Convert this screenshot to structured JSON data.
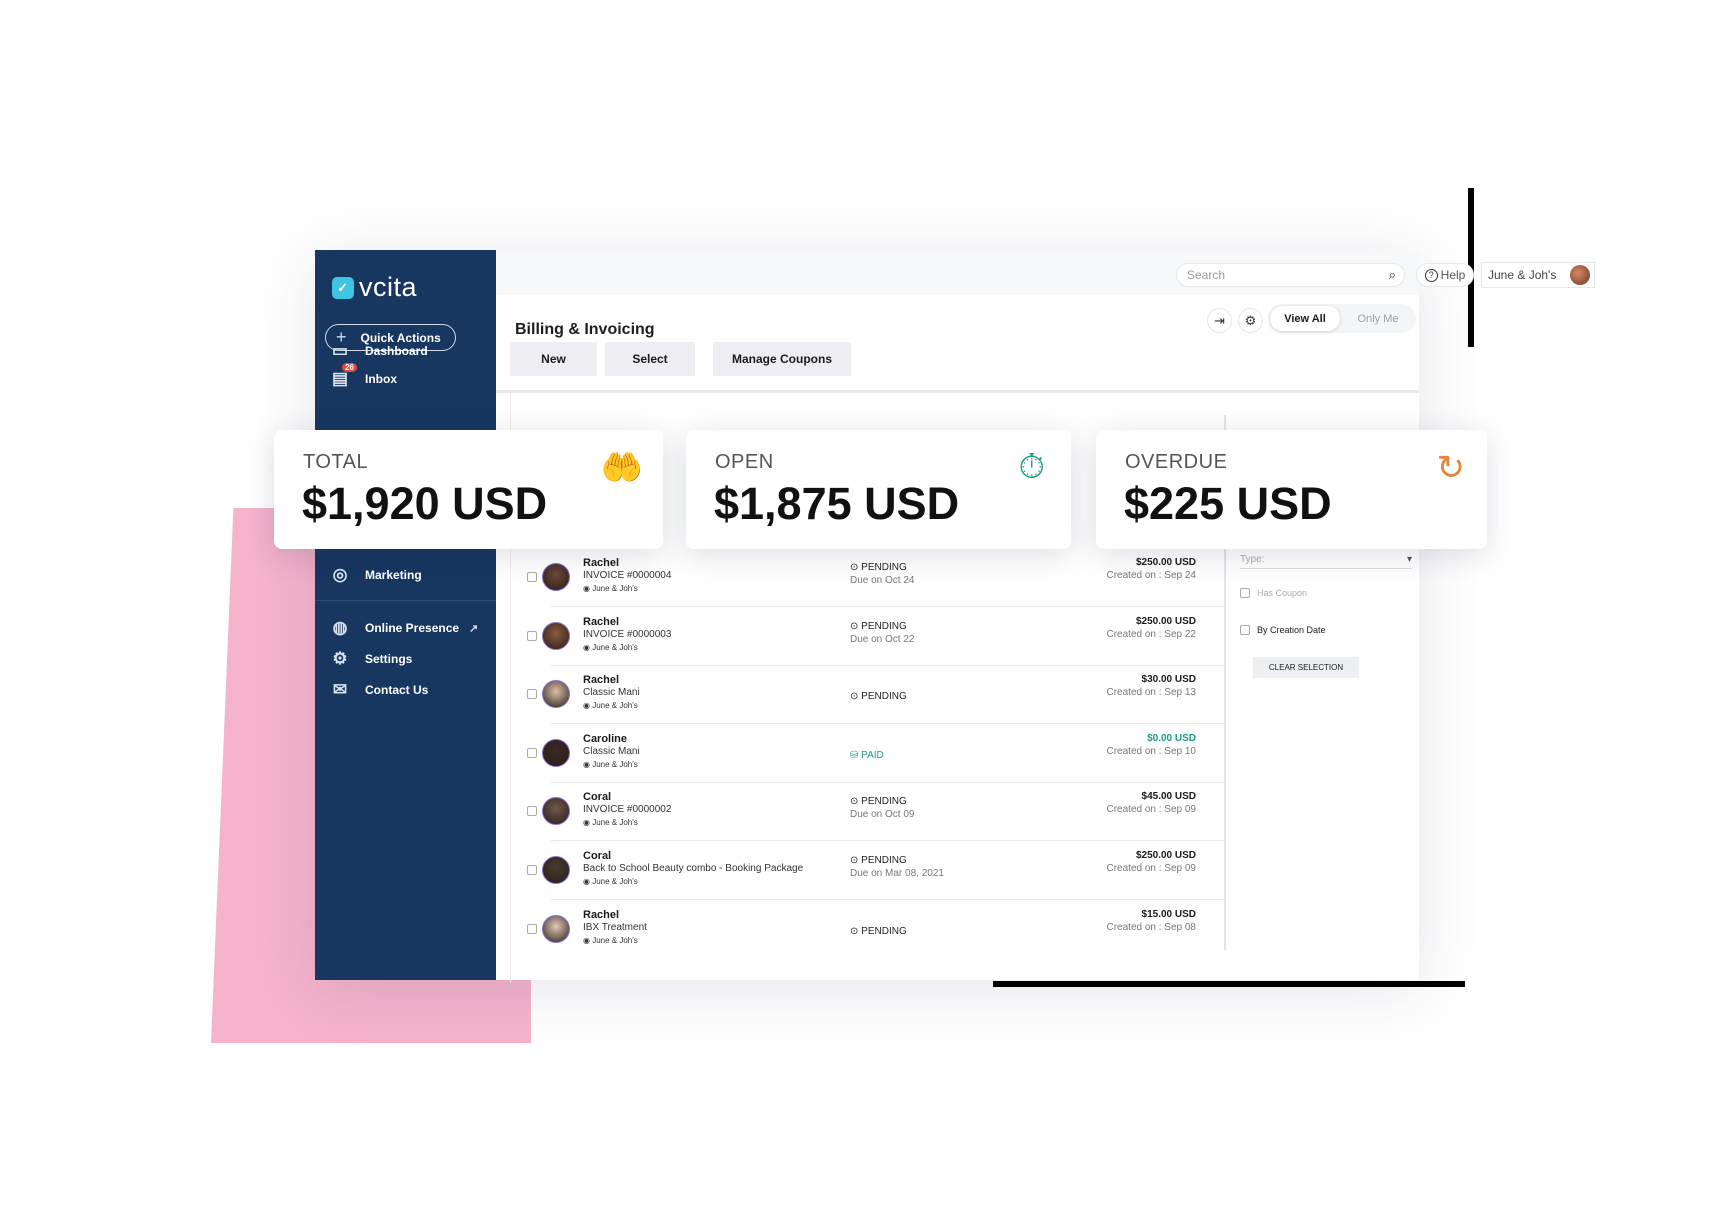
{
  "brand": {
    "name": "vcita"
  },
  "sidebar": {
    "quick_actions": "Quick Actions",
    "items": [
      {
        "label": "Dashboard",
        "icon": "devices-icon"
      },
      {
        "label": "Inbox",
        "icon": "inbox-icon",
        "badge": "26"
      },
      {
        "label": "Marketing",
        "icon": "target-icon"
      },
      {
        "label": "Online Presence",
        "icon": "globe-icon"
      },
      {
        "label": "Settings",
        "icon": "gears-icon"
      },
      {
        "label": "Contact Us",
        "icon": "envelope-icon"
      }
    ]
  },
  "topbar": {
    "search_placeholder": "Search",
    "help": "Help",
    "account": "June & Joh's"
  },
  "header": {
    "title": "Billing & Invoicing",
    "buttons": [
      "New",
      "Select",
      "Manage Coupons"
    ],
    "view_all": "View All",
    "only_me": "Only Me"
  },
  "cards": [
    {
      "label": "TOTAL",
      "value": "$1,920 USD",
      "icon": "hand-coins-icon",
      "color": "#111111"
    },
    {
      "label": "OPEN",
      "value": "$1,875 USD",
      "icon": "stopwatch-icon",
      "color": "#1a9c82"
    },
    {
      "label": "OVERDUE",
      "value": "$225 USD",
      "icon": "clock-check-icon",
      "color": "#e8843a"
    }
  ],
  "rows": [
    {
      "name": "Rachel",
      "desc": "INVOICE #0000004",
      "location": "June & Joh's",
      "status": "PENDING",
      "due": "Due on Oct 24",
      "amount": "$250.00 USD",
      "created": "Created on : Sep 24"
    },
    {
      "name": "Rachel",
      "desc": "INVOICE #0000003",
      "location": "June & Joh's",
      "status": "PENDING",
      "due": "Due on Oct 22",
      "amount": "$250.00 USD",
      "created": "Created on : Sep 22"
    },
    {
      "name": "Rachel",
      "desc": "Classic Mani",
      "location": "June & Joh's",
      "status": "PENDING",
      "due": "",
      "amount": "$30.00 USD",
      "created": "Created on : Sep 13"
    },
    {
      "name": "Caroline",
      "desc": "Classic Mani",
      "location": "June & Joh's",
      "status": "PAID",
      "due": "",
      "amount": "$0.00 USD",
      "created": "Created on : Sep 10"
    },
    {
      "name": "Coral",
      "desc": "INVOICE #0000002",
      "location": "June & Joh's",
      "status": "PENDING",
      "due": "Due on Oct 09",
      "amount": "$45.00 USD",
      "created": "Created on : Sep 09"
    },
    {
      "name": "Coral",
      "desc": "Back to School Beauty combo - Booking Package",
      "location": "June & Joh's",
      "status": "PENDING",
      "due": "Due on Mar 08, 2021",
      "amount": "$250.00 USD",
      "created": "Created on : Sep 09"
    },
    {
      "name": "Rachel",
      "desc": "IBX Treatment",
      "location": "June & Joh's",
      "status": "PENDING",
      "due": "",
      "amount": "$15.00 USD",
      "created": "Created on : Sep 08"
    }
  ],
  "filter": {
    "type_label": "Type:",
    "has_coupon": "Has Coupon",
    "by_creation_date": "By Creation Date",
    "clear": "CLEAR SELECTION"
  },
  "colors": {
    "sidebar": "#173660",
    "paid": "#1a9c82",
    "accent_pink": "#f5b3cc"
  }
}
